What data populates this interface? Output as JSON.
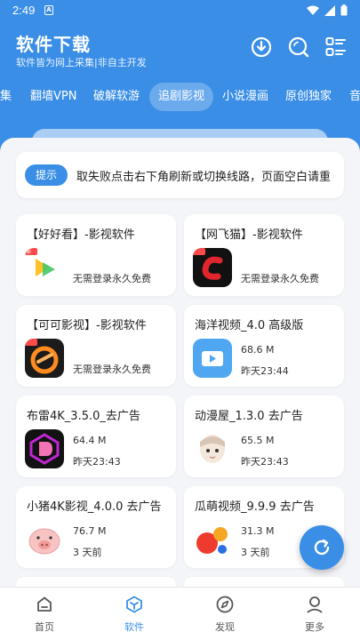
{
  "status": {
    "time": "2:49"
  },
  "header": {
    "title": "软件下载",
    "subtitle": "软件皆为网上采集|非自主开发"
  },
  "tabs": [
    {
      "label": "集"
    },
    {
      "label": "翻墙VPN"
    },
    {
      "label": "破解软游"
    },
    {
      "label": "追剧影视",
      "active": true
    },
    {
      "label": "小说漫画"
    },
    {
      "label": "原创独家"
    },
    {
      "label": "音"
    }
  ],
  "notice": {
    "tag": "提示",
    "message": "取失败点击右下角刷新或切换线路，页面空白请重"
  },
  "cards": [
    {
      "name": "【好好看】-影视软件",
      "desc": "无需登录永久免费",
      "icon": "haohaokan-logo"
    },
    {
      "name": "【网飞猫】-影视软件",
      "desc": "无需登录永久免费",
      "icon": "wangfeimao-logo"
    },
    {
      "name": "【可可影视】-影视软件",
      "desc": "无需登录永久免费",
      "icon": "keke-logo"
    },
    {
      "name": "海洋视频_4.0 高级版",
      "size": "68.6 M",
      "time": "昨天23:44",
      "icon": "haiyang-logo"
    },
    {
      "name": "布雷4K_3.5.0_去广告",
      "size": "64.4 M",
      "time": "昨天23:43",
      "icon": "bulei-logo"
    },
    {
      "name": "动漫屋_1.3.0 去广告",
      "size": "65.5 M",
      "time": "昨天23:43",
      "icon": "dongmanwu-logo"
    },
    {
      "name": "小猪4K影视_4.0.0 去广告",
      "size": "76.7 M",
      "time": "3 天前",
      "icon": "pig-logo"
    },
    {
      "name": "瓜萌视频_9.9.9 去广告",
      "size": "31.3 M",
      "time": "3 天前",
      "icon": "guameng-logo"
    }
  ],
  "nav": [
    {
      "label": "首页",
      "icon": "home-icon"
    },
    {
      "label": "软件",
      "icon": "software-icon",
      "active": true
    },
    {
      "label": "发现",
      "icon": "compass-icon"
    },
    {
      "label": "更多",
      "icon": "user-icon"
    }
  ],
  "colors": {
    "primary": "#3a8ee6",
    "background": "#f3f5f8"
  }
}
